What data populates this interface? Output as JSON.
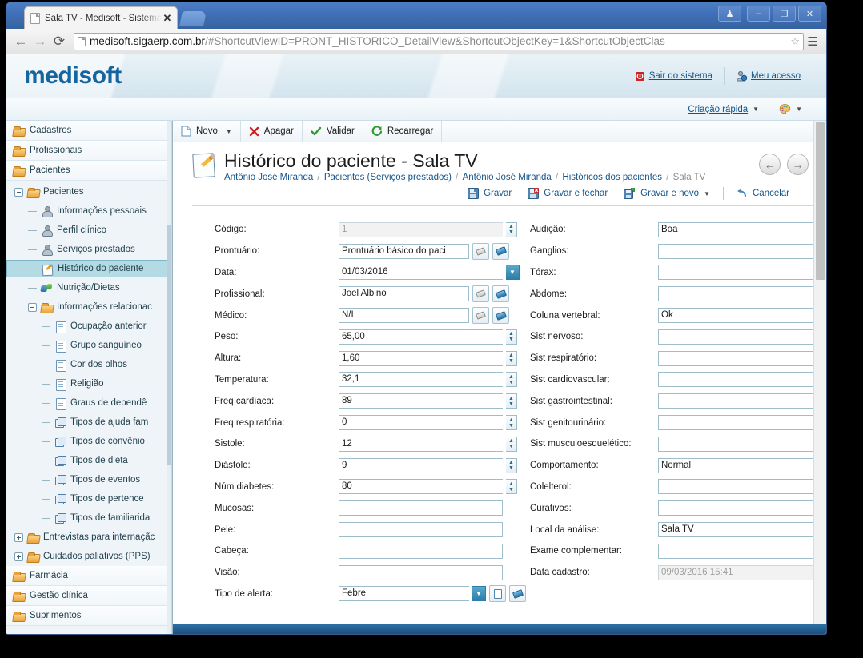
{
  "browser": {
    "tab_title": "Sala TV - Medisoft - Sistema d",
    "tab_close": "✕",
    "back_icon": "←",
    "forward_icon": "→",
    "reload_icon": "⟳",
    "url_host": "medisoft.sigaerp.com.br",
    "url_path": "/#ShortcutViewID=PRONT_HISTORICO_DetailView&ShortcutObjectKey=1&ShortcutObjectClas",
    "star_icon": "☆",
    "menu_icon": "☰",
    "win_user": "♟",
    "win_minimize": "–",
    "win_restore": "❐",
    "win_close": "✕"
  },
  "app_header": {
    "logo": "medisoft",
    "logout_label": "Sair do sistema",
    "account_label": "Meu acesso"
  },
  "subbar": {
    "quick_create_label": "Criação rápida",
    "caret": "▼",
    "theme_caret": "▼"
  },
  "sidebar": {
    "roots_top": [
      {
        "label": "Cadastros",
        "icon": "folder-icon"
      },
      {
        "label": "Profissionais",
        "icon": "folder-icon"
      },
      {
        "label": "Pacientes",
        "icon": "folder-icon"
      }
    ],
    "tree": [
      {
        "label": "Pacientes",
        "icon": "folder-icon",
        "level": 1,
        "expander": "minus"
      },
      {
        "label": "Informações pessoais",
        "icon": "person-icon",
        "level": 2,
        "expander": "stub"
      },
      {
        "label": "Perfil clínico",
        "icon": "person-icon",
        "level": 2,
        "expander": "stub"
      },
      {
        "label": "Serviços prestados",
        "icon": "person-icon",
        "level": 2,
        "expander": "stub"
      },
      {
        "label": "Histórico do paciente",
        "icon": "pencil-icon",
        "level": 2,
        "expander": "stub",
        "selected": true
      },
      {
        "label": "Nutrição/Dietas",
        "icon": "nutrition-icon",
        "level": 2,
        "expander": "stub"
      },
      {
        "label": "Informações relacionac",
        "icon": "folder-icon",
        "level": 2,
        "expander": "minus"
      },
      {
        "label": "Ocupação anterior",
        "icon": "doc-icon",
        "level": 3,
        "expander": "stub"
      },
      {
        "label": "Grupo sanguíneo",
        "icon": "doc-icon",
        "level": 3,
        "expander": "stub"
      },
      {
        "label": "Cor dos olhos",
        "icon": "doc-icon",
        "level": 3,
        "expander": "stub"
      },
      {
        "label": "Religião",
        "icon": "doc-icon",
        "level": 3,
        "expander": "stub"
      },
      {
        "label": "Graus de dependê",
        "icon": "doc-icon",
        "level": 3,
        "expander": "stub"
      },
      {
        "label": "Tipos de ajuda fam",
        "icon": "cube-icon",
        "level": 3,
        "expander": "stub"
      },
      {
        "label": "Tipos de convênio",
        "icon": "cube-icon",
        "level": 3,
        "expander": "stub"
      },
      {
        "label": "Tipos de dieta",
        "icon": "cube-icon",
        "level": 3,
        "expander": "stub"
      },
      {
        "label": "Tipos de eventos",
        "icon": "cube-icon",
        "level": 3,
        "expander": "stub"
      },
      {
        "label": "Tipos de pertence",
        "icon": "cube-icon",
        "level": 3,
        "expander": "stub"
      },
      {
        "label": "Tipos de familiarida",
        "icon": "cube-icon",
        "level": 3,
        "expander": "stub"
      },
      {
        "label": "Entrevistas para internaçãc",
        "icon": "folder-icon",
        "level": 1,
        "expander": "plus"
      },
      {
        "label": "Cuidados paliativos (PPS)",
        "icon": "folder-icon",
        "level": 1,
        "expander": "plus"
      }
    ],
    "roots_bottom": [
      {
        "label": "Farmácia",
        "icon": "folder-icon"
      },
      {
        "label": "Gestão clínica",
        "icon": "folder-icon"
      },
      {
        "label": "Suprimentos",
        "icon": "folder-icon"
      }
    ]
  },
  "toolbar": {
    "new_label": "Novo",
    "new_caret": "▼",
    "delete_label": "Apagar",
    "validate_label": "Validar",
    "reload_label": "Recarregar"
  },
  "page": {
    "title": "Histórico do paciente - Sala TV",
    "breadcrumb": [
      {
        "text": "Antônio José Miranda",
        "link": true
      },
      {
        "text": "Pacientes (Serviços prestados)",
        "link": true
      },
      {
        "text": "Antônio José Miranda",
        "link": true
      },
      {
        "text": "Históricos dos pacientes",
        "link": true
      },
      {
        "text": "Sala TV",
        "link": false
      }
    ],
    "prev_icon": "←",
    "next_icon": "→"
  },
  "actions": {
    "save_label": "Gravar",
    "save_close_label": "Gravar e fechar",
    "save_new_label": "Gravar e novo",
    "save_new_caret": "▼",
    "cancel_label": "Cancelar"
  },
  "form": {
    "left": [
      {
        "label": "Código:",
        "value": "1",
        "type": "spinner",
        "disabled": true
      },
      {
        "label": "Prontuário:",
        "value": "Prontuário básico do paci",
        "type": "lookup"
      },
      {
        "label": "Data:",
        "value": "01/03/2016",
        "type": "date"
      },
      {
        "label": "Profissional:",
        "value": "Joel Albino",
        "type": "lookup"
      },
      {
        "label": "Médico:",
        "value": "N/I",
        "type": "lookup"
      },
      {
        "label": "Peso:",
        "value": "65,00",
        "type": "spinner"
      },
      {
        "label": "Altura:",
        "value": "1,60",
        "type": "spinner"
      },
      {
        "label": "Temperatura:",
        "value": "32,1",
        "type": "spinner"
      },
      {
        "label": "Freq cardíaca:",
        "value": "89",
        "type": "spinner"
      },
      {
        "label": "Freq respiratória:",
        "value": "0",
        "type": "spinner"
      },
      {
        "label": "Sistole:",
        "value": "12",
        "type": "spinner"
      },
      {
        "label": "Diástole:",
        "value": "9",
        "type": "spinner"
      },
      {
        "label": "Núm diabetes:",
        "value": "80",
        "type": "spinner"
      },
      {
        "label": "Mucosas:",
        "value": "",
        "type": "text"
      },
      {
        "label": "Pele:",
        "value": "",
        "type": "text"
      },
      {
        "label": "Cabeça:",
        "value": "",
        "type": "text"
      },
      {
        "label": "Visão:",
        "value": "",
        "type": "text"
      },
      {
        "label": "Tipo de alerta:",
        "value": "Febre",
        "type": "combo"
      }
    ],
    "right": [
      {
        "label": "Audição:",
        "value": "Boa",
        "type": "text"
      },
      {
        "label": "Ganglios:",
        "value": "",
        "type": "text"
      },
      {
        "label": "Tórax:",
        "value": "",
        "type": "text"
      },
      {
        "label": "Abdome:",
        "value": "",
        "type": "text"
      },
      {
        "label": "Coluna vertebral:",
        "value": "Ok",
        "type": "text"
      },
      {
        "label": "Sist nervoso:",
        "value": "",
        "type": "text"
      },
      {
        "label": "Sist respiratório:",
        "value": "",
        "type": "text"
      },
      {
        "label": "Sist cardiovascular:",
        "value": "",
        "type": "text"
      },
      {
        "label": "Sist gastrointestinal:",
        "value": "",
        "type": "text"
      },
      {
        "label": "Sist genitourinário:",
        "value": "",
        "type": "text"
      },
      {
        "label": "Sist musculoesquelético:",
        "value": "",
        "type": "text"
      },
      {
        "label": "Comportamento:",
        "value": "Normal",
        "type": "text"
      },
      {
        "label": "Colelterol:",
        "value": "",
        "type": "text"
      },
      {
        "label": "Curativos:",
        "value": "",
        "type": "text"
      },
      {
        "label": "Local da análise:",
        "value": "Sala TV",
        "type": "text"
      },
      {
        "label": "Exame complementar:",
        "value": "",
        "type": "text"
      },
      {
        "label": "Data cadastro:",
        "value": "09/03/2016 15:41",
        "type": "datetime",
        "disabled": true
      }
    ]
  },
  "colors": {
    "brand": "#15659e",
    "link": "#15548a",
    "selection": "#b4dbe4",
    "input_border": "#9dbdca"
  }
}
